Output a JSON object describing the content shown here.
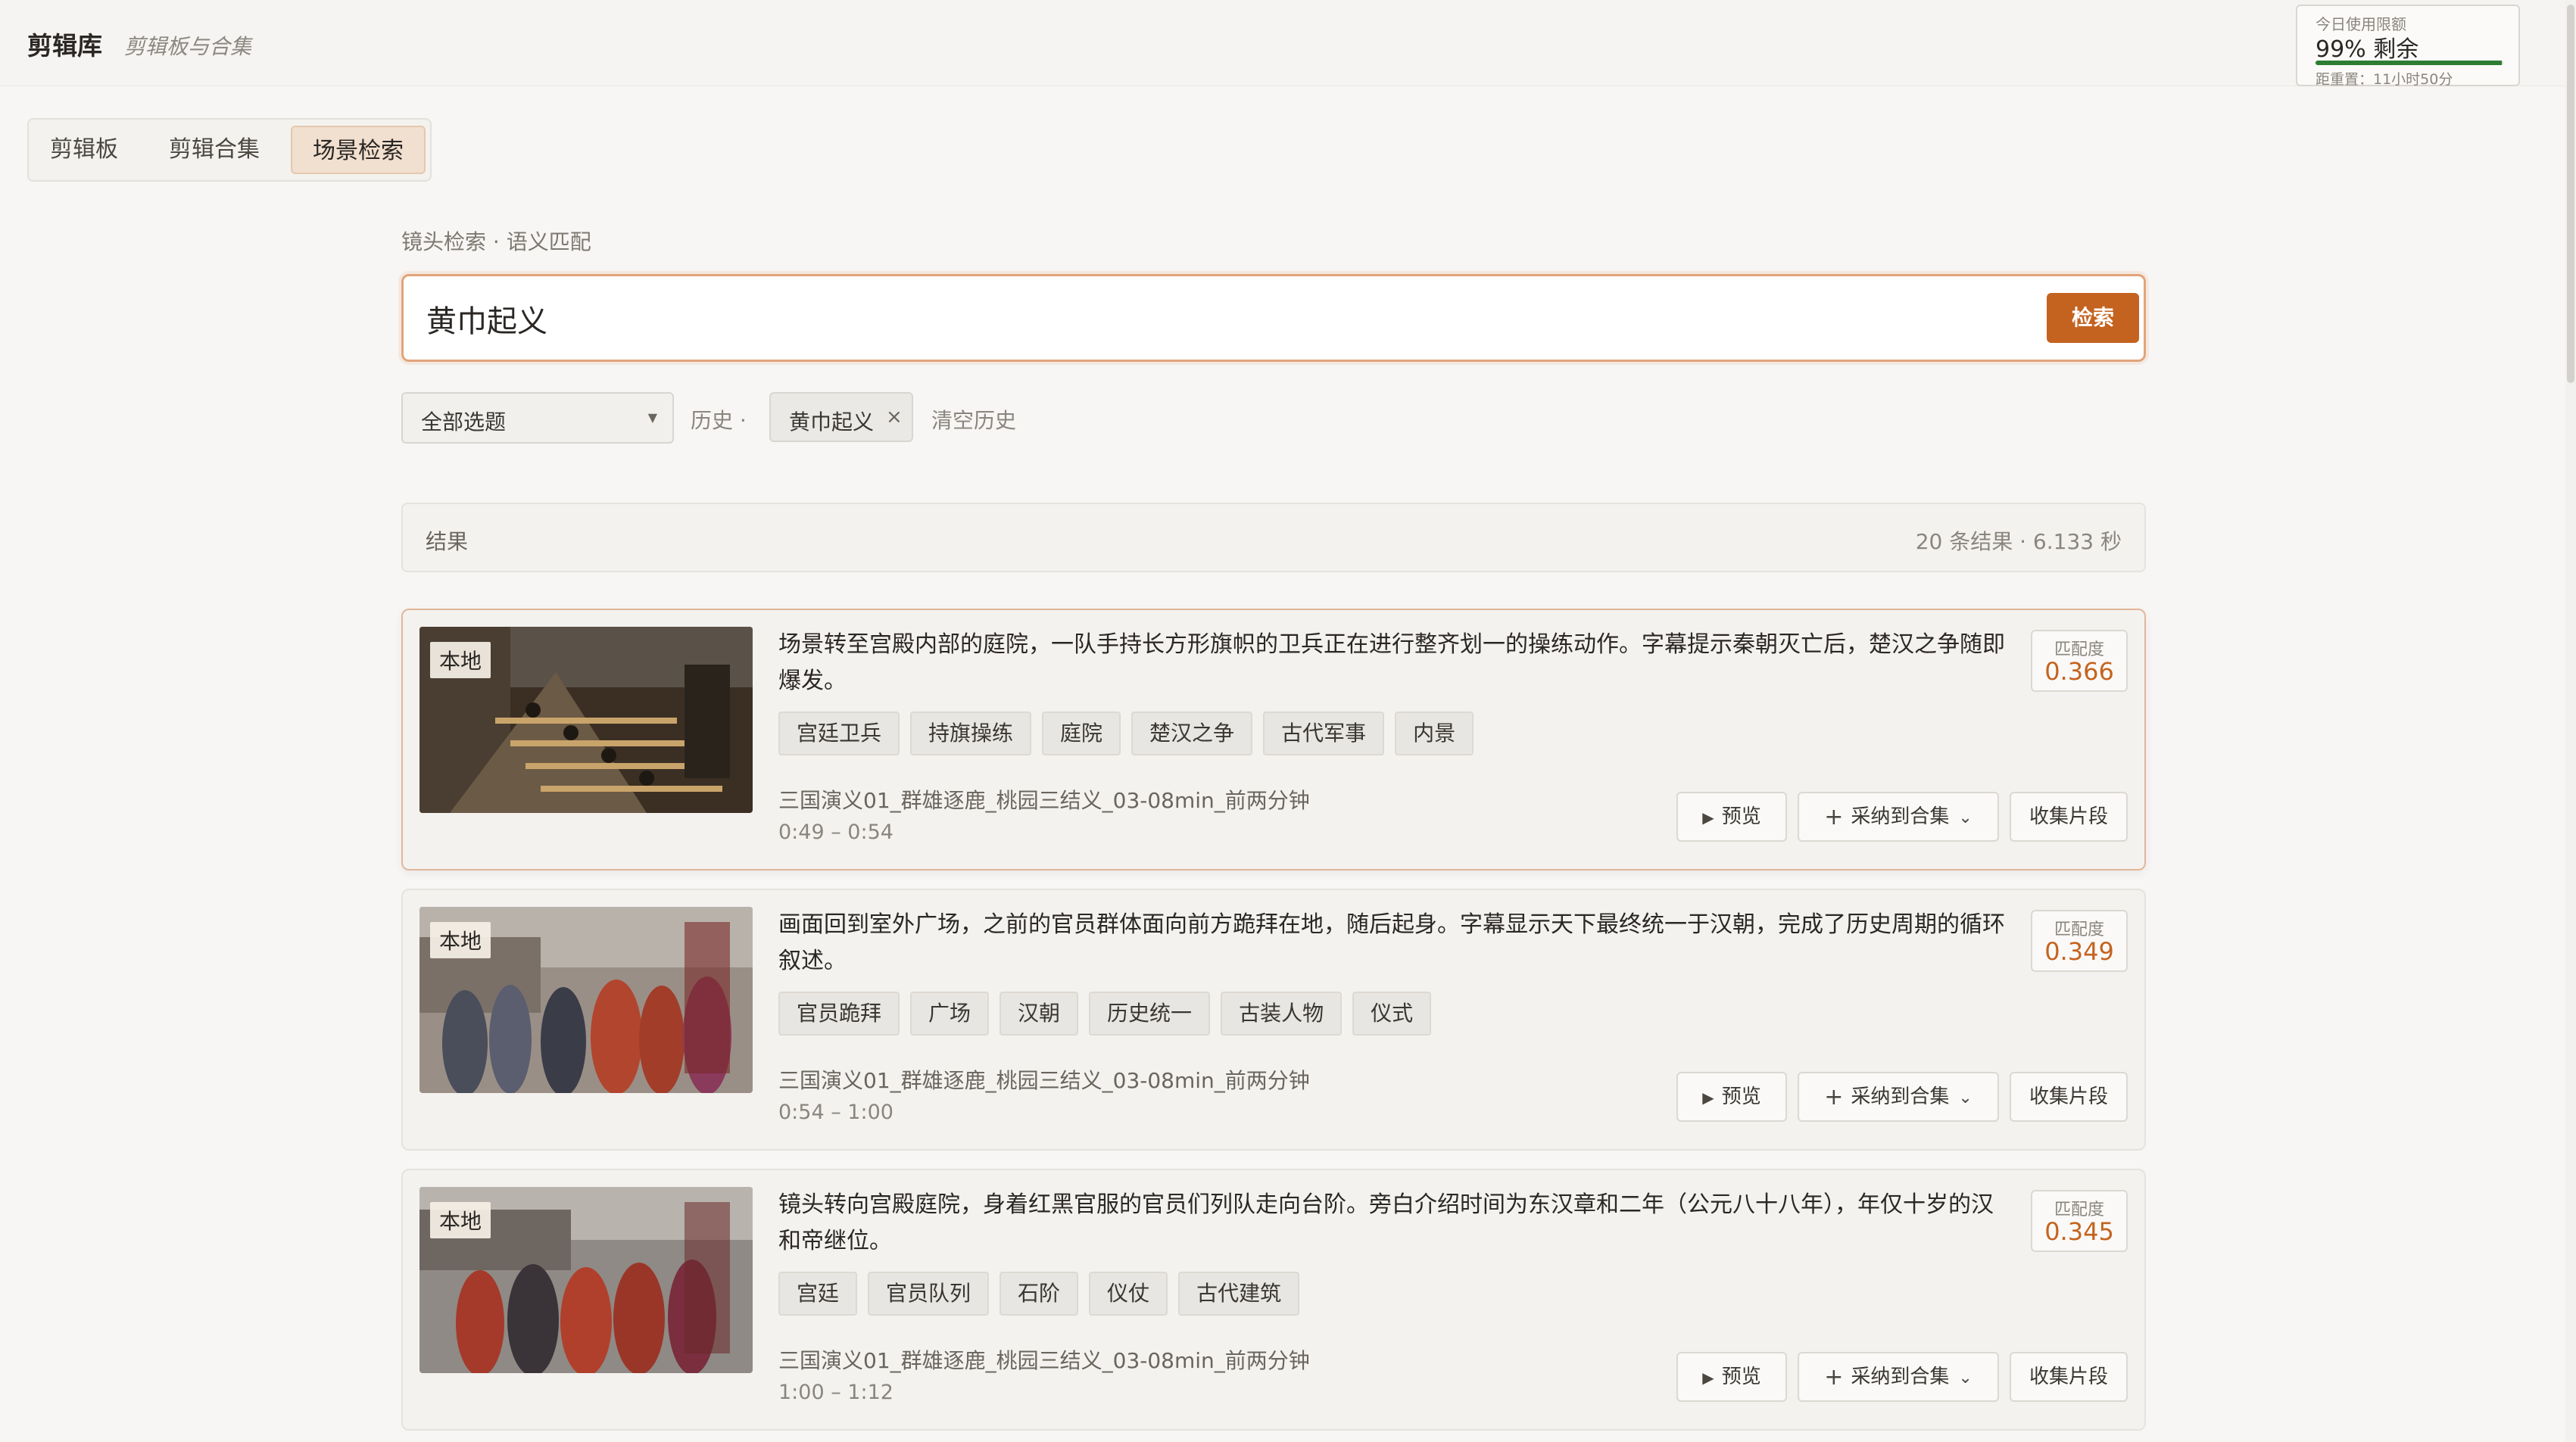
{
  "app": {
    "title": "剪辑库",
    "subtitle": "剪辑板与合集"
  },
  "quota": {
    "label": "今日使用限额",
    "value": "99% 剩余",
    "remaining_fraction": 0.99,
    "reset": "距重置：11小时50分"
  },
  "tabs": [
    {
      "label": "剪辑板",
      "active": false
    },
    {
      "label": "剪辑合集",
      "active": false
    },
    {
      "label": "场景检索",
      "active": true
    }
  ],
  "search": {
    "section_label": "镜头检索 · 语义匹配",
    "query": "黄巾起义",
    "button": "检索"
  },
  "filters": {
    "topic_select": "全部选题",
    "history_label": "历史 ·",
    "history_items": [
      "黄巾起义"
    ],
    "clear_history": "清空历史"
  },
  "results": {
    "title": "结果",
    "meta": "20 条结果 · 6.133 秒",
    "items": [
      {
        "badge": "本地",
        "description": "场景转至宫殿内部的庭院，一队手持长方形旗帜的卫兵正在进行整齐划一的操练动作。字幕提示秦朝灭亡后，楚汉之争随即爆发。",
        "tags": [
          "宫廷卫兵",
          "持旗操练",
          "庭院",
          "楚汉之争",
          "古代军事",
          "内景"
        ],
        "source": "三国演义01_群雄逐鹿_桃园三结义_03-08min_前两分钟",
        "time": "0:49 – 0:54",
        "score_label": "匹配度",
        "score": "0.366",
        "preview": "预览",
        "adopt": "采纳到合集",
        "collect": "收集片段"
      },
      {
        "badge": "本地",
        "description": "画面回到室外广场，之前的官员群体面向前方跪拜在地，随后起身。字幕显示天下最终统一于汉朝，完成了历史周期的循环叙述。",
        "tags": [
          "官员跪拜",
          "广场",
          "汉朝",
          "历史统一",
          "古装人物",
          "仪式"
        ],
        "source": "三国演义01_群雄逐鹿_桃园三结义_03-08min_前两分钟",
        "time": "0:54 – 1:00",
        "score_label": "匹配度",
        "score": "0.349",
        "preview": "预览",
        "adopt": "采纳到合集",
        "collect": "收集片段"
      },
      {
        "badge": "本地",
        "description": "镜头转向宫殿庭院，身着红黑官服的官员们列队走向台阶。旁白介绍时间为东汉章和二年（公元八十八年），年仅十岁的汉和帝继位。",
        "tags": [
          "宫廷",
          "官员队列",
          "石阶",
          "仪仗",
          "古代建筑"
        ],
        "source": "三国演义01_群雄逐鹿_桃园三结义_03-08min_前两分钟",
        "time": "1:00 – 1:12",
        "score_label": "匹配度",
        "score": "0.345",
        "preview": "预览",
        "adopt": "采纳到合集",
        "collect": "收集片段"
      }
    ]
  },
  "colors": {
    "accent": "#c4631f",
    "quota_bar": "#2e7d32"
  }
}
